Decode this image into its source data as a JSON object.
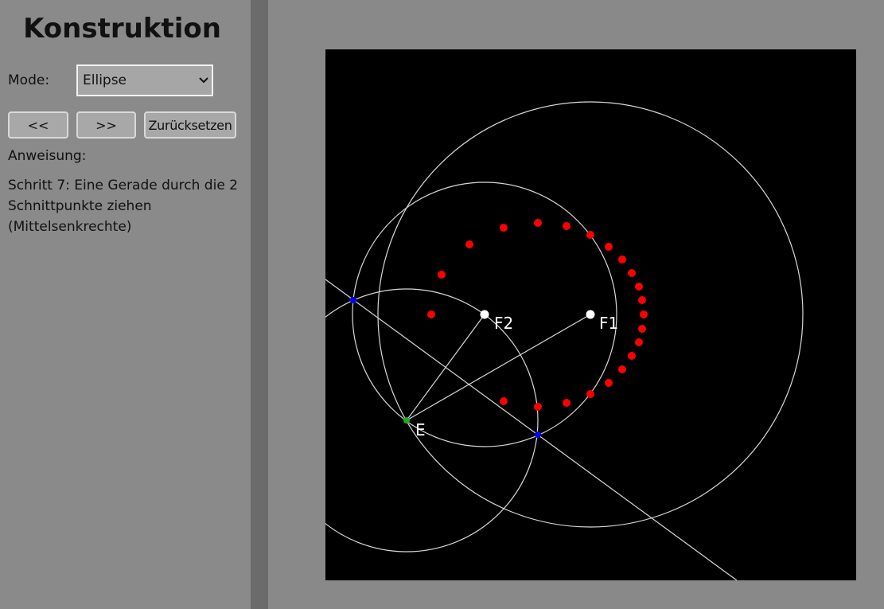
{
  "sidebar": {
    "title": "Konstruktion",
    "mode_label": "Mode:",
    "mode_value": "Ellipse",
    "prev_label": "<<",
    "next_label": ">>",
    "reset_label": "Zurücksetzen",
    "instruction_label": "Anweisung:",
    "instruction_text": "Schritt 7: Eine Gerade durch die 2 Schnittpunkte ziehen (Mittelsenkrechte)"
  },
  "canvas": {
    "point_labels": {
      "f1": "F1",
      "f2": "F2",
      "e": "E"
    },
    "colors": {
      "background": "#000000",
      "construction": "#d8d8d8",
      "ellipse_points": "#ff0000",
      "foci": "#ffffff",
      "intersections": "#0000ff",
      "current_point": "#22aa22"
    }
  }
}
